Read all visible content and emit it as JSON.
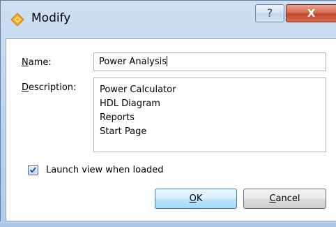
{
  "window": {
    "title": "Modify",
    "help_button_glyph": "?",
    "close_button_glyph": "X",
    "title_icon": "diamond-app-icon"
  },
  "form": {
    "name_label_accel": "N",
    "name_label_rest": "ame:",
    "name_value": "Power Analysis",
    "description_label_accel": "D",
    "description_label_rest": "escription:",
    "description_lines": [
      "Power Calculator",
      "HDL Diagram",
      "Reports",
      "Start Page"
    ],
    "launch_checkbox_label": "Launch view when loaded",
    "launch_checked": true
  },
  "buttons": {
    "ok_accel": "O",
    "ok_rest": "K",
    "cancel_accel": "C",
    "cancel_rest": "ancel"
  },
  "colors": {
    "icon_primary": "#f5a623",
    "icon_secondary": "#f7d24b",
    "check_color": "#1d4f91",
    "close_red": "#c2462b"
  }
}
